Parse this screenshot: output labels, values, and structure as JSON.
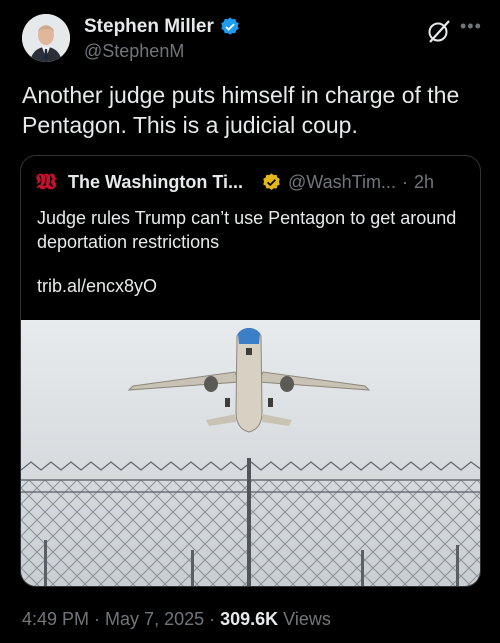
{
  "author": {
    "display_name": "Stephen Miller",
    "handle": "@StephenM"
  },
  "tweet": {
    "text": "Another judge puts himself in charge of the Pentagon. This is a judicial coup."
  },
  "quoted": {
    "display_name": "The Washington Ti...",
    "handle": "@WashTim...",
    "separator": "·",
    "time": "2h",
    "text": "Judge rules Trump can’t use Pentagon to get around deportation restrictions",
    "link": "trib.al/encx8yO"
  },
  "meta": {
    "time": "4:49 PM",
    "dot1": " · ",
    "date": "May 7, 2025",
    "dot2": " · ",
    "views_count": "309.6K",
    "views_label": " Views"
  },
  "icons": {
    "verified": "verified-badge-icon",
    "gold_verified": "gold-verified-badge-icon",
    "grok": "grok-icon",
    "more": "more-icon"
  },
  "colors": {
    "background": "#000000",
    "text": "#e7e9ea",
    "secondary": "#71767b",
    "verified_blue": "#1d9bf0",
    "verified_gold": "#e2b719",
    "logo_red": "#c8102e"
  }
}
